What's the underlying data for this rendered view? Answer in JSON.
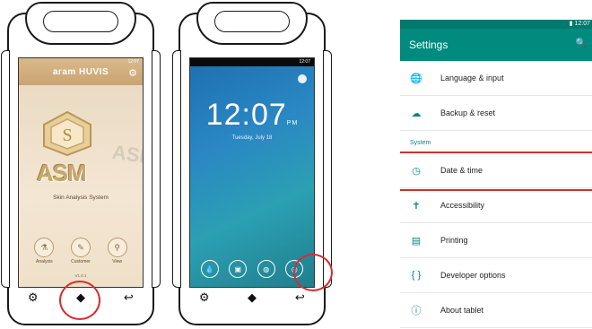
{
  "device1": {
    "status_time": "12:07",
    "brand": "aram HUVIS",
    "logo_text": "ASM",
    "subtitle": "Skin Analysis System",
    "buttons": [
      {
        "label": "Analysis",
        "icon": "flask-icon",
        "glyph": "⚗"
      },
      {
        "label": "Customer",
        "icon": "customer-icon",
        "glyph": "✎"
      },
      {
        "label": "View",
        "icon": "magnifier-icon",
        "glyph": "⚲"
      }
    ],
    "version": "V1.0.1"
  },
  "device2": {
    "status_time": "12:07",
    "time": "12:07",
    "ampm": "PM",
    "date": "Tuesday, July 18",
    "shortcuts": [
      "droplet-icon",
      "image-icon",
      "globe-icon",
      "lens-icon"
    ]
  },
  "settings": {
    "status_time": "12:07",
    "title": "Settings",
    "section_label": "System",
    "items_top": [
      {
        "label": "Language & input",
        "icon": "globe-icon",
        "glyph": "🌐"
      },
      {
        "label": "Backup & reset",
        "icon": "cloud-upload-icon",
        "glyph": "☁"
      }
    ],
    "items_system": [
      {
        "label": "Date & time",
        "icon": "clock-icon",
        "glyph": "◷",
        "highlighted": true
      },
      {
        "label": "Accessibility",
        "icon": "accessibility-icon",
        "glyph": "✝"
      },
      {
        "label": "Printing",
        "icon": "printer-icon",
        "glyph": "▤"
      },
      {
        "label": "Developer options",
        "icon": "code-braces-icon",
        "glyph": "{ }"
      },
      {
        "label": "About tablet",
        "icon": "info-icon",
        "glyph": "ⓘ"
      }
    ]
  },
  "colors": {
    "highlight": "#d32f2f",
    "settings_accent": "#018a7e",
    "asm_gold": "#c9a86b"
  }
}
